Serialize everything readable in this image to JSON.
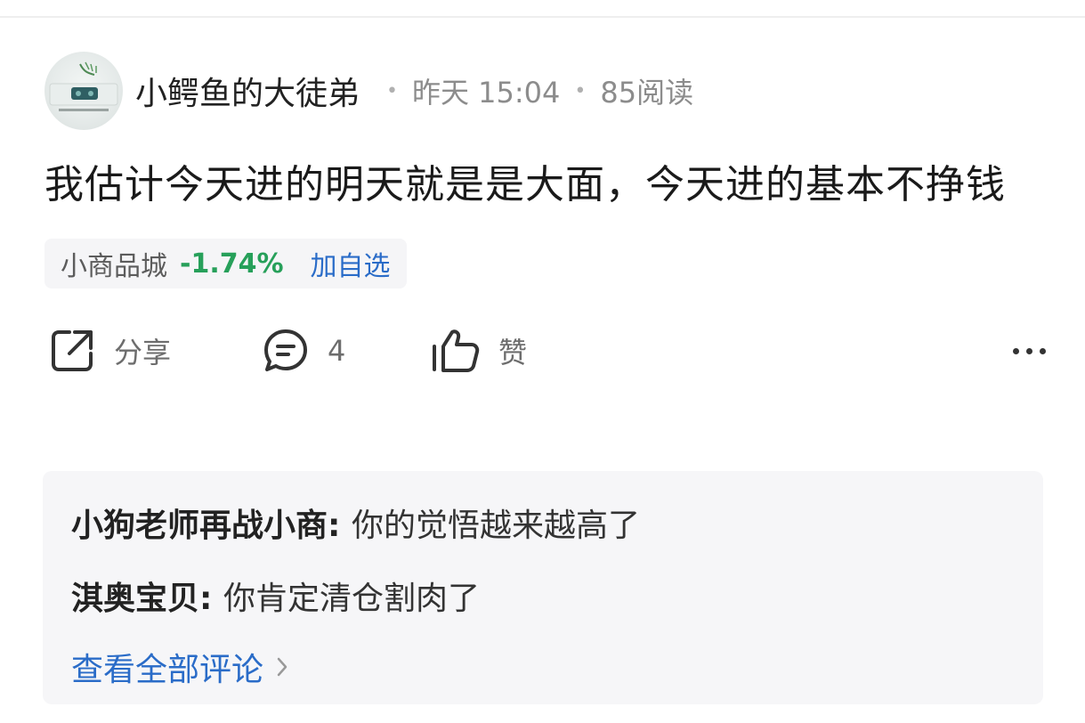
{
  "post": {
    "author": "小鳄鱼的大徒弟",
    "time": "昨天 15:04",
    "reads": "85阅读",
    "content": "我估计今天进的明天就是是大面，今天进的基本不挣钱"
  },
  "stock": {
    "name": "小商品城",
    "change": "-1.74%",
    "add_label": "加自选",
    "change_color": "#27a05a"
  },
  "actions": {
    "share_label": "分享",
    "comment_count": "4",
    "like_label": "赞"
  },
  "comments": [
    {
      "author": "小狗老师再战小商",
      "text": "你的觉悟越来越高了"
    },
    {
      "author": "淇奥宝贝",
      "text": "你肯定清仓割肉了"
    }
  ],
  "view_all_label": "查看全部评论",
  "colors": {
    "accent": "#2a6cc8",
    "down": "#27a05a",
    "muted": "#8c8c8c"
  }
}
